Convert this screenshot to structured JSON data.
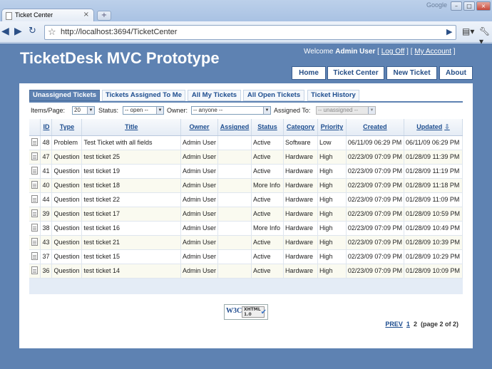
{
  "browser": {
    "tab_title": "Ticket Center",
    "tab_close": "×",
    "new_tab": "+",
    "brand": "Google",
    "address": "http://localhost:3694/TicketCenter"
  },
  "site": {
    "title": "TicketDesk MVC Prototype",
    "welcome_prefix": "Welcome",
    "user": "Admin User",
    "logoff": "Log Off",
    "my_account": "My Account",
    "menu": [
      "Home",
      "Ticket Center",
      "New Ticket",
      "About"
    ]
  },
  "subtabs": [
    {
      "label": "Unassigned Tickets",
      "active": true
    },
    {
      "label": "Tickets Assigned To Me",
      "active": false
    },
    {
      "label": "All My Tickets",
      "active": false
    },
    {
      "label": "All Open Tickets",
      "active": false
    },
    {
      "label": "Ticket History",
      "active": false
    }
  ],
  "filters": {
    "items_per_page_label": "Items/Page:",
    "items_per_page": "20",
    "status_label": "Status:",
    "status": "-- open --",
    "owner_label": "Owner:",
    "owner": "-- anyone --",
    "assigned_label": "Assigned To:",
    "assigned": "-- unassigned --"
  },
  "columns": [
    "ID",
    "Type",
    "Title",
    "Owner",
    "Assigned",
    "Status",
    "Category",
    "Priority",
    "Created",
    "Updated"
  ],
  "rows": [
    {
      "id": "48",
      "type": "Problem",
      "title": "Test Ticket with all fields",
      "owner": "Admin User",
      "assigned": "",
      "status": "Active",
      "category": "Software",
      "priority": "Low",
      "created": "06/11/09 06:29 PM",
      "updated": "06/11/09 06:29 PM"
    },
    {
      "id": "47",
      "type": "Question",
      "title": "test ticket 25",
      "owner": "Admin User",
      "assigned": "",
      "status": "Active",
      "category": "Hardware",
      "priority": "High",
      "created": "02/23/09 07:09 PM",
      "updated": "01/28/09 11:39 PM"
    },
    {
      "id": "41",
      "type": "Question",
      "title": "test ticket 19",
      "owner": "Admin User",
      "assigned": "",
      "status": "Active",
      "category": "Hardware",
      "priority": "High",
      "created": "02/23/09 07:09 PM",
      "updated": "01/28/09 11:19 PM"
    },
    {
      "id": "40",
      "type": "Question",
      "title": "test ticket 18",
      "owner": "Admin User",
      "assigned": "",
      "status": "More Info",
      "category": "Hardware",
      "priority": "High",
      "created": "02/23/09 07:09 PM",
      "updated": "01/28/09 11:18 PM"
    },
    {
      "id": "44",
      "type": "Question",
      "title": "test ticket 22",
      "owner": "Admin User",
      "assigned": "",
      "status": "Active",
      "category": "Hardware",
      "priority": "High",
      "created": "02/23/09 07:09 PM",
      "updated": "01/28/09 11:09 PM"
    },
    {
      "id": "39",
      "type": "Question",
      "title": "test ticket 17",
      "owner": "Admin User",
      "assigned": "",
      "status": "Active",
      "category": "Hardware",
      "priority": "High",
      "created": "02/23/09 07:09 PM",
      "updated": "01/28/09 10:59 PM"
    },
    {
      "id": "38",
      "type": "Question",
      "title": "test ticket 16",
      "owner": "Admin User",
      "assigned": "",
      "status": "More Info",
      "category": "Hardware",
      "priority": "High",
      "created": "02/23/09 07:09 PM",
      "updated": "01/28/09 10:49 PM"
    },
    {
      "id": "43",
      "type": "Question",
      "title": "test ticket 21",
      "owner": "Admin User",
      "assigned": "",
      "status": "Active",
      "category": "Hardware",
      "priority": "High",
      "created": "02/23/09 07:09 PM",
      "updated": "01/28/09 10:39 PM"
    },
    {
      "id": "37",
      "type": "Question",
      "title": "test ticket 15",
      "owner": "Admin User",
      "assigned": "",
      "status": "Active",
      "category": "Hardware",
      "priority": "High",
      "created": "02/23/09 07:09 PM",
      "updated": "01/28/09 10:29 PM"
    },
    {
      "id": "36",
      "type": "Question",
      "title": "test ticket 14",
      "owner": "Admin User",
      "assigned": "",
      "status": "Active",
      "category": "Hardware",
      "priority": "High",
      "created": "02/23/09 07:09 PM",
      "updated": "01/28/09 10:09 PM"
    }
  ],
  "pager": {
    "prev": "PREV",
    "page1": "1",
    "page2": "2",
    "info": "(page 2 of 2)"
  },
  "badge": {
    "w3c": "W3C",
    "xhtml": "XHTML",
    "version": "1.0"
  },
  "icons": {
    "doc": "document-icon",
    "sort": "sort-desc-arrow-icon"
  },
  "colors": {
    "header_blue": "#5e82b2",
    "link_blue": "#1d4d8f",
    "alt_row": "#fafaf0"
  }
}
